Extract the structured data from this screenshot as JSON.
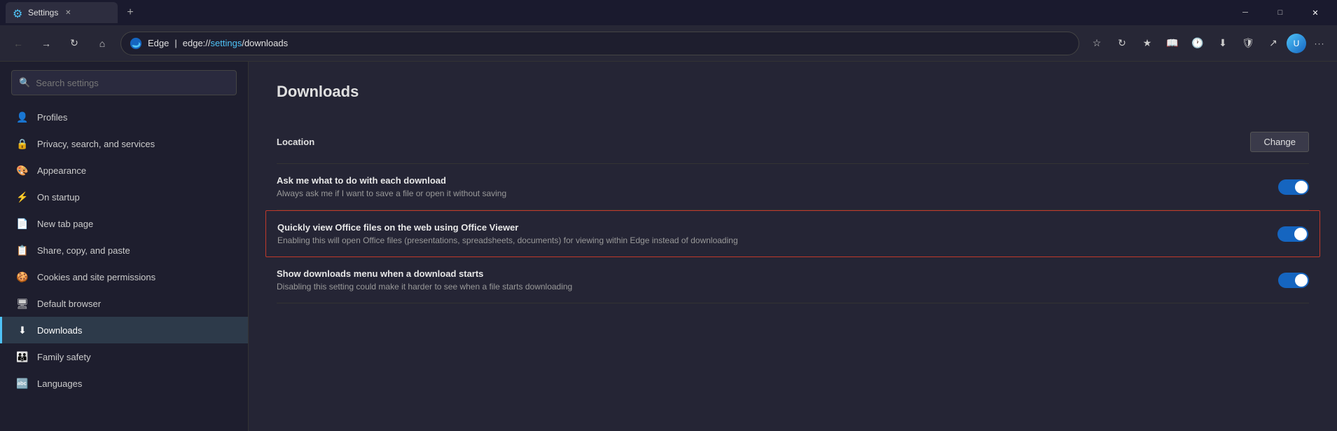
{
  "titleBar": {
    "tab": {
      "label": "Settings",
      "icon": "⚙"
    },
    "newTab": "+",
    "winControls": {
      "minimize": "─",
      "maximize": "□",
      "close": "✕"
    }
  },
  "navBar": {
    "back": "←",
    "forward": "→",
    "refresh": "↻",
    "home": "⌂",
    "brandName": "Edge",
    "addressBar": {
      "prefix": "edge://",
      "link": "settings",
      "suffix": "/downloads"
    },
    "toolbarIcons": [
      "⭐",
      "🔄",
      "⭐",
      "🌐",
      "🕐",
      "⬇",
      "🛡",
      "↗"
    ],
    "moreIcon": "···"
  },
  "sidebar": {
    "searchPlaceholder": "Search settings",
    "navItems": [
      {
        "id": "search-settings",
        "icon": "🔍",
        "label": "Search settings"
      },
      {
        "id": "profiles",
        "icon": "👤",
        "label": "Profiles"
      },
      {
        "id": "privacy",
        "icon": "🔒",
        "label": "Privacy, search, and services"
      },
      {
        "id": "appearance",
        "icon": "🎨",
        "label": "Appearance"
      },
      {
        "id": "on-startup",
        "icon": "⚡",
        "label": "On startup"
      },
      {
        "id": "new-tab",
        "icon": "📄",
        "label": "New tab page"
      },
      {
        "id": "share-copy",
        "icon": "📋",
        "label": "Share, copy, and paste"
      },
      {
        "id": "cookies",
        "icon": "🍪",
        "label": "Cookies and site permissions"
      },
      {
        "id": "default-browser",
        "icon": "🖥",
        "label": "Default browser"
      },
      {
        "id": "downloads",
        "icon": "⬇",
        "label": "Downloads"
      },
      {
        "id": "family-safety",
        "icon": "👪",
        "label": "Family safety"
      },
      {
        "id": "languages",
        "icon": "🔤",
        "label": "Languages"
      }
    ]
  },
  "content": {
    "pageTitle": "Downloads",
    "locationRow": {
      "label": "Location",
      "changeBtn": "Change"
    },
    "settings": [
      {
        "id": "ask-download",
        "title": "Ask me what to do with each download",
        "desc": "Always ask me if I want to save a file or open it without saving",
        "enabled": true,
        "highlighted": false
      },
      {
        "id": "office-viewer",
        "title": "Quickly view Office files on the web using Office Viewer",
        "desc": "Enabling this will open Office files (presentations, spreadsheets, documents) for viewing within Edge instead of downloading",
        "enabled": true,
        "highlighted": true
      },
      {
        "id": "show-downloads-menu",
        "title": "Show downloads menu when a download starts",
        "desc": "Disabling this setting could make it harder to see when a file starts downloading",
        "enabled": true,
        "highlighted": false
      }
    ]
  }
}
